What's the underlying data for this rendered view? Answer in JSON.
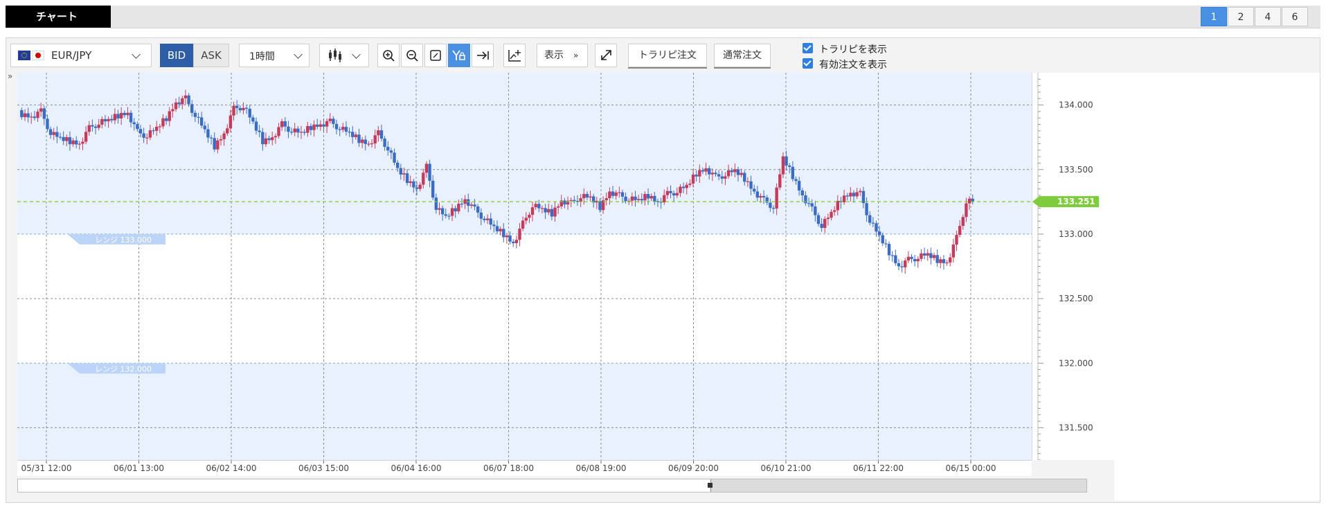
{
  "tabs": {
    "active": "チャート",
    "pages": [
      "1",
      "2",
      "4",
      "6"
    ],
    "active_page": "1"
  },
  "toolbar": {
    "symbol": "EUR/JPY",
    "bid": "BID",
    "ask": "ASK",
    "timeframe": "1時間",
    "display": "表示",
    "trap_order": "トラリピ注文",
    "normal_order": "通常注文",
    "show_trap": "トラリピを表示",
    "show_active": "有効注文を表示",
    "icons": [
      "candlestick-icon",
      "zoom-in-icon",
      "zoom-out-icon",
      "fit-icon",
      "crosshair-icon",
      "jump-end-icon",
      "add-indicator-icon",
      "expand-icon"
    ]
  },
  "chart": {
    "y_ticks": [
      "134.000",
      "133.500",
      "133.000",
      "132.500",
      "132.000",
      "131.500"
    ],
    "x_ticks": [
      "05/31 12:00",
      "06/01 13:00",
      "06/02 14:00",
      "06/03 15:00",
      "06/04 16:00",
      "06/07 18:00",
      "06/08 19:00",
      "06/09 20:00",
      "06/10 21:00",
      "06/11 22:00",
      "06/15 00:00"
    ],
    "current_price": "133.251",
    "range_labels": [
      "レンジ 133.000",
      "レンジ 132.000"
    ],
    "colors": {
      "up": "#c63b5a",
      "down": "#3a6cc4",
      "range_fill": "#e9f1fe",
      "current": "#7ccc3c"
    }
  },
  "chart_data": {
    "type": "candlestick",
    "ylim": [
      131.25,
      134.25
    ],
    "y_ticks": [
      134.0,
      133.5,
      133.0,
      132.5,
      132.0,
      131.5
    ],
    "current_price": 133.251,
    "close_path": [
      133.93,
      133.91,
      133.95,
      133.78,
      133.74,
      133.72,
      133.7,
      133.82,
      133.86,
      133.88,
      133.92,
      133.94,
      133.79,
      133.76,
      133.82,
      133.9,
      134.02,
      134.05,
      133.92,
      133.8,
      133.68,
      133.78,
      133.97,
      133.99,
      133.86,
      133.72,
      133.75,
      133.85,
      133.8,
      133.78,
      133.83,
      133.85,
      133.87,
      133.82,
      133.78,
      133.73,
      133.7,
      133.78,
      133.66,
      133.5,
      133.42,
      133.35,
      133.52,
      133.2,
      133.13,
      133.2,
      133.27,
      133.19,
      133.12,
      133.05,
      133.0,
      132.93,
      133.08,
      133.22,
      133.19,
      133.16,
      133.26,
      133.24,
      133.29,
      133.28,
      133.21,
      133.33,
      133.3,
      133.27,
      133.26,
      133.3,
      133.25,
      133.31,
      133.33,
      133.37,
      133.47,
      133.51,
      133.44,
      133.46,
      133.49,
      133.43,
      133.33,
      133.26,
      133.21,
      133.59,
      133.45,
      133.3,
      133.19,
      133.06,
      133.16,
      133.27,
      133.32,
      133.31,
      133.1,
      132.98,
      132.86,
      132.75,
      132.8,
      132.82,
      132.84,
      132.8,
      132.78,
      132.97,
      133.25
    ],
    "range_lines": [
      133.0,
      132.0
    ]
  }
}
